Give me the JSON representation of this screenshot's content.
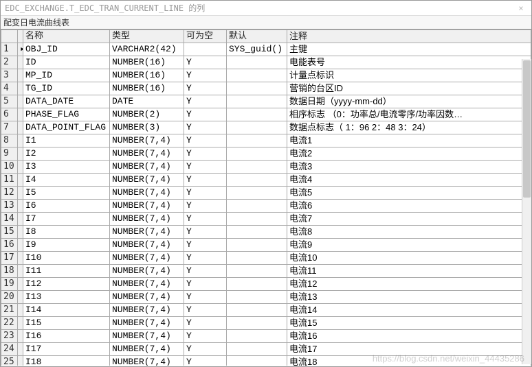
{
  "window": {
    "title": "EDC_EXCHANGE.T_EDC_TRAN_CURRENT_LINE 的列",
    "close_icon": "×"
  },
  "subtitle": "配变日电流曲线表",
  "headers": {
    "row_marker": "",
    "name": "名称",
    "type": "类型",
    "nullable": "可为空",
    "default": "默认",
    "comment": "注释"
  },
  "rows": [
    {
      "n": "1",
      "mk": "▸",
      "name": "OBJ_ID",
      "type": "VARCHAR2(42)",
      "null": "",
      "def": "SYS_guid()",
      "cmt": "主键"
    },
    {
      "n": "2",
      "mk": "",
      "name": "ID",
      "type": "NUMBER(16)",
      "null": "Y",
      "def": "",
      "cmt": "电能表号"
    },
    {
      "n": "3",
      "mk": "",
      "name": "MP_ID",
      "type": "NUMBER(16)",
      "null": "Y",
      "def": "",
      "cmt": "计量点标识"
    },
    {
      "n": "4",
      "mk": "",
      "name": "TG_ID",
      "type": "NUMBER(16)",
      "null": "Y",
      "def": "",
      "cmt": "营销的台区ID"
    },
    {
      "n": "5",
      "mk": "",
      "name": "DATA_DATE",
      "type": "DATE",
      "null": "Y",
      "def": "",
      "cmt": "数据日期（yyyy-mm-dd）"
    },
    {
      "n": "6",
      "mk": "",
      "name": "PHASE_FLAG",
      "type": "NUMBER(2)",
      "null": "Y",
      "def": "",
      "cmt": "相序标志  （0：功率总/电流零序/功率因数…"
    },
    {
      "n": "7",
      "mk": "",
      "name": "DATA_POINT_FLAG",
      "type": "NUMBER(3)",
      "null": "Y",
      "def": "",
      "cmt": "数据点标志（ 1：96 2：48 3：24）"
    },
    {
      "n": "8",
      "mk": "",
      "name": "I1",
      "type": "NUMBER(7,4)",
      "null": "Y",
      "def": "",
      "cmt": "电流1"
    },
    {
      "n": "9",
      "mk": "",
      "name": "I2",
      "type": "NUMBER(7,4)",
      "null": "Y",
      "def": "",
      "cmt": "电流2"
    },
    {
      "n": "10",
      "mk": "",
      "name": "I3",
      "type": "NUMBER(7,4)",
      "null": "Y",
      "def": "",
      "cmt": "电流3"
    },
    {
      "n": "11",
      "mk": "",
      "name": "I4",
      "type": "NUMBER(7,4)",
      "null": "Y",
      "def": "",
      "cmt": "电流4"
    },
    {
      "n": "12",
      "mk": "",
      "name": "I5",
      "type": "NUMBER(7,4)",
      "null": "Y",
      "def": "",
      "cmt": "电流5"
    },
    {
      "n": "13",
      "mk": "",
      "name": "I6",
      "type": "NUMBER(7,4)",
      "null": "Y",
      "def": "",
      "cmt": "电流6"
    },
    {
      "n": "14",
      "mk": "",
      "name": "I7",
      "type": "NUMBER(7,4)",
      "null": "Y",
      "def": "",
      "cmt": "电流7"
    },
    {
      "n": "15",
      "mk": "",
      "name": "I8",
      "type": "NUMBER(7,4)",
      "null": "Y",
      "def": "",
      "cmt": "电流8"
    },
    {
      "n": "16",
      "mk": "",
      "name": "I9",
      "type": "NUMBER(7,4)",
      "null": "Y",
      "def": "",
      "cmt": "电流9"
    },
    {
      "n": "17",
      "mk": "",
      "name": "I10",
      "type": "NUMBER(7,4)",
      "null": "Y",
      "def": "",
      "cmt": "电流10"
    },
    {
      "n": "18",
      "mk": "",
      "name": "I11",
      "type": "NUMBER(7,4)",
      "null": "Y",
      "def": "",
      "cmt": "电流11"
    },
    {
      "n": "19",
      "mk": "",
      "name": "I12",
      "type": "NUMBER(7,4)",
      "null": "Y",
      "def": "",
      "cmt": "电流12"
    },
    {
      "n": "20",
      "mk": "",
      "name": "I13",
      "type": "NUMBER(7,4)",
      "null": "Y",
      "def": "",
      "cmt": "电流13"
    },
    {
      "n": "21",
      "mk": "",
      "name": "I14",
      "type": "NUMBER(7,4)",
      "null": "Y",
      "def": "",
      "cmt": "电流14"
    },
    {
      "n": "22",
      "mk": "",
      "name": "I15",
      "type": "NUMBER(7,4)",
      "null": "Y",
      "def": "",
      "cmt": "电流15"
    },
    {
      "n": "23",
      "mk": "",
      "name": "I16",
      "type": "NUMBER(7,4)",
      "null": "Y",
      "def": "",
      "cmt": "电流16"
    },
    {
      "n": "24",
      "mk": "",
      "name": "I17",
      "type": "NUMBER(7,4)",
      "null": "Y",
      "def": "",
      "cmt": "电流17"
    },
    {
      "n": "25",
      "mk": "",
      "name": "I18",
      "type": "NUMBER(7,4)",
      "null": "Y",
      "def": "",
      "cmt": "电流18"
    }
  ],
  "watermark": "https://blog.csdn.net/weixin_44435286"
}
